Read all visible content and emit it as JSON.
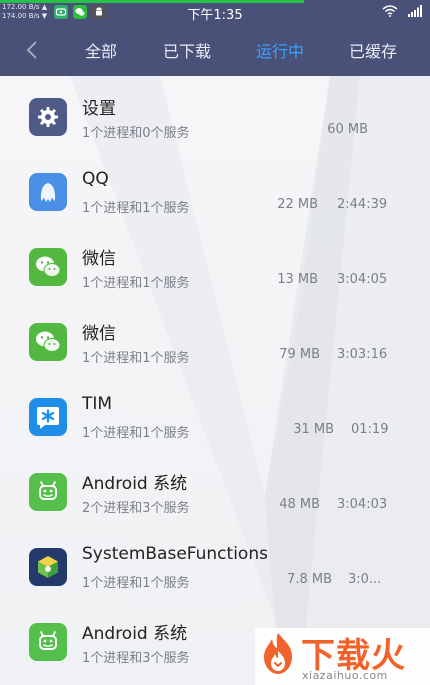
{
  "status_bar": {
    "net_speed_up": "172.00 B/s ▲",
    "net_speed_down": "174.00 B/s ▼",
    "time": "下午1:35",
    "notification_icons": [
      "tv-app-icon",
      "wechat-icon",
      "android-robot-icon"
    ]
  },
  "tabs": [
    {
      "label": "全部",
      "active": false
    },
    {
      "label": "已下载",
      "active": false
    },
    {
      "label": "运行中",
      "active": true
    },
    {
      "label": "已缓存",
      "active": false
    }
  ],
  "colors": {
    "header_bg": "#4a5178",
    "active_tab": "#3aa3ff",
    "accent_line": "#28c04a",
    "watermark_orange": "#f0632b"
  },
  "apps": [
    {
      "name": "设置",
      "sub": "1个进程和0个服务",
      "memory": "60 MB",
      "duration": "",
      "icon": "settings-gear-icon"
    },
    {
      "name": "QQ",
      "sub": "1个进程和1个服务",
      "memory": "22 MB",
      "duration": "2:44:39",
      "icon": "qq-penguin-icon"
    },
    {
      "name": "微信",
      "sub": "1个进程和1个服务",
      "memory": "13 MB",
      "duration": "3:04:05",
      "icon": "wechat-icon"
    },
    {
      "name": "微信",
      "sub": "1个进程和1个服务",
      "memory": "79 MB",
      "duration": "3:03:16",
      "icon": "wechat-icon"
    },
    {
      "name": "TIM",
      "sub": "1个进程和1个服务",
      "memory": "31 MB",
      "duration": "01:19",
      "icon": "tim-star-icon"
    },
    {
      "name": "Android 系统",
      "sub": "2个进程和3个服务",
      "memory": "48 MB",
      "duration": "3:04:03",
      "icon": "android-robot-icon"
    },
    {
      "name": "SystemBaseFunctions",
      "sub": "1个进程和1个服务",
      "memory": "7.8 MB",
      "duration": "3:0...",
      "icon": "system-base-icon"
    },
    {
      "name": "Android 系统",
      "sub": "1个进程和3个服务",
      "memory": "",
      "duration": "",
      "icon": "android-robot-icon"
    }
  ],
  "watermark": {
    "title": "下载火",
    "url": "xiazaihuo.com"
  }
}
